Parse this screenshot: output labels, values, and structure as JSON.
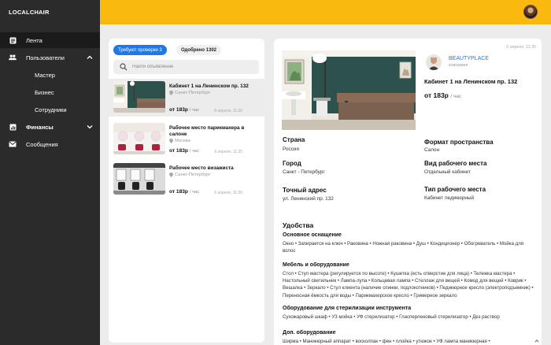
{
  "app": {
    "logo": "LOCALCHAIR"
  },
  "sidebar": {
    "items": [
      {
        "label": "Лента",
        "icon": "feed-icon"
      },
      {
        "label": "Пользователи",
        "icon": "users-icon"
      },
      {
        "label": "Мастер"
      },
      {
        "label": "Бизнес"
      },
      {
        "label": "Сотрудники"
      },
      {
        "label": "Финансы",
        "icon": "finance-icon"
      },
      {
        "label": "Сообщения",
        "icon": "mail-icon"
      }
    ]
  },
  "listing": {
    "tabs": [
      {
        "label": "Требуют проверки 3",
        "active": true
      },
      {
        "label": "Одобрено 1302",
        "active": false
      }
    ],
    "search": {
      "placeholder": "Найти объявление"
    },
    "cards": [
      {
        "title": "Кабинет 1 на Ленинском пр. 132",
        "city": "Санкт-Петербург",
        "price": "от 183р",
        "unit": "/ час",
        "date": "6 апреля, 11:35"
      },
      {
        "title": "Рабочее место парикмахера в салоне",
        "city": "Москва",
        "price": "от 183р",
        "unit": "/ час",
        "date": "6 апреля, 11:35"
      },
      {
        "title": "Рабочее место визажиста",
        "city": "Санкт-Петербург",
        "price": "от 183р",
        "unit": "/ час",
        "date": "6 апреля, 11:35"
      }
    ]
  },
  "detail": {
    "date": "6 апреля, 11:35",
    "owner": {
      "name": "BEAUTYPLACE",
      "role": "коворкинг"
    },
    "title": "Кабинет 1 на Ленинском пр. 132",
    "price": "от 183р",
    "unit": "/ час",
    "fields": [
      {
        "label": "Страна",
        "value": "Россия"
      },
      {
        "label": "Формат пространства",
        "value": "Салон"
      },
      {
        "label": "Город",
        "value": "Санкт - Петербург"
      },
      {
        "label": "Вид рабочего места",
        "value": "Отдельный кабинет"
      },
      {
        "label": "Точный адрес",
        "value": "ул. Ленинский пр. 132"
      },
      {
        "label": "Тип рабочего места",
        "value": "Кабинет педикюрный"
      }
    ],
    "amenities_title": "Удобства",
    "groups": [
      {
        "title": "Основное оснащение",
        "text": "Окно • Запирается на ключ • Раковина • Ножная раковина • Душ • Кондиционер • Обогреватель • Мойка для волос"
      },
      {
        "title": "Мебель и оборудование",
        "text": "Стол • Стул мастера (регулируется по высоте) • Кушетка (есть отверстие для лица) • Тележка мастера • Настольный светильник • Лампа-лупа • Кольцевая лампа • Стеллаж для вещей • Комод для вещей • Коврик • Вешалка • Зеркало • Стул клиента (наличие спинки, подлокотников) • Педикюрное кресло (электроподъемник) • Переносная ёмкость для воды • Парикмахерское кресло • Гримерное зеркало"
      },
      {
        "title": "Оборудование для стерилизации инструмента",
        "text": "Сухожаровый шкаф • УЗ мойка • УФ стерилизатор • Гласперленовый стерилизатор • Дез раствор"
      },
      {
        "title": "Доп. оборудование",
        "text": "Ширма • Маникюрный аппарат • восколпак • фен • плойка • утюжок • УФ лампа маникюрная •"
      }
    ]
  },
  "colors": {
    "accent": "#f9b90f",
    "primary": "#1e78e8",
    "sidebar": "#2b2b2b"
  }
}
